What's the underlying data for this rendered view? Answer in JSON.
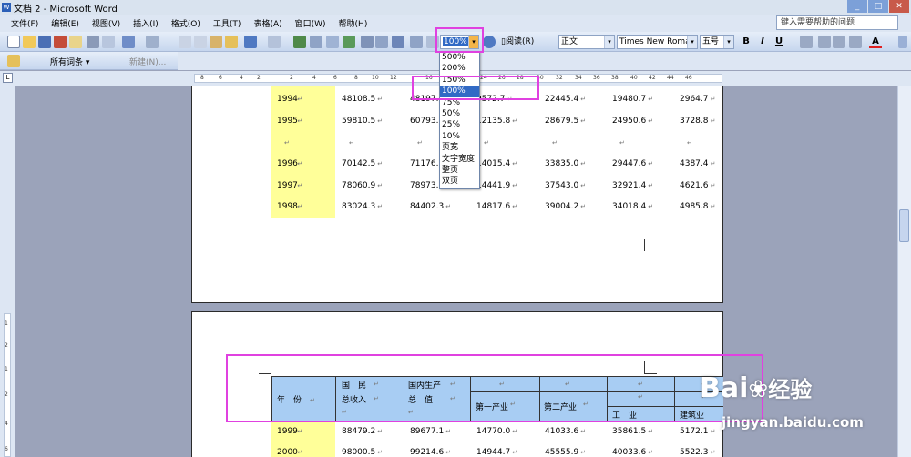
{
  "window": {
    "title": "文档 2 - Microsoft Word"
  },
  "menu": [
    "文件(F)",
    "编辑(E)",
    "视图(V)",
    "插入(I)",
    "格式(O)",
    "工具(T)",
    "表格(A)",
    "窗口(W)",
    "帮助(H)"
  ],
  "help": {
    "placeholder": "键入需要帮助的问题"
  },
  "toolbar": {
    "zoom_value": "100%",
    "read_label": "阅读(R)",
    "style_value": "正文",
    "font_value": "Times New Roman",
    "size_value": "五号",
    "bold": "B",
    "italic": "I",
    "underline": "U",
    "font_color": "A"
  },
  "toolbar2": {
    "all_entries": "所有词条",
    "new_label": "新建(N)..."
  },
  "ruler": {
    "ticks": [
      "8",
      "6",
      "4",
      "2",
      "2",
      "4",
      "6",
      "8",
      "10",
      "12",
      "16",
      "20",
      "22",
      "24",
      "26",
      "28",
      "30",
      "32",
      "34",
      "36",
      "38",
      "40",
      "42",
      "44",
      "46"
    ]
  },
  "vruler": {
    "ticks": [
      "1",
      "2",
      "1",
      "2",
      "4",
      "6"
    ]
  },
  "zoom_options": [
    "500%",
    "200%",
    "150%",
    "100%",
    "75%",
    "50%",
    "25%",
    "10%",
    "页宽",
    "文字宽度",
    "整页",
    "双页"
  ],
  "zoom_selected_index": 3,
  "table1": {
    "rows": [
      {
        "year": "1994",
        "c1": "48108.5",
        "c2": "48197.0",
        "c3": "9572.7",
        "c4": "22445.4",
        "c5": "19480.7",
        "c6": "2964.7"
      },
      {
        "year": "1995",
        "c1": "59810.5",
        "c2": "60793.7",
        "c3": "12135.8",
        "c4": "28679.5",
        "c5": "24950.6",
        "c6": "3728.8"
      },
      {
        "year": "",
        "c1": "",
        "c2": "",
        "c3": "",
        "c4": "",
        "c5": "",
        "c6": ""
      },
      {
        "year": "1996",
        "c1": "70142.5",
        "c2": "71176.6",
        "c3": "14015.4",
        "c4": "33835.0",
        "c5": "29447.6",
        "c6": "4387.4"
      },
      {
        "year": "1997",
        "c1": "78060.9",
        "c2": "78973.0",
        "c3": "14441.9",
        "c4": "37543.0",
        "c5": "32921.4",
        "c6": "4621.6"
      },
      {
        "year": "1998",
        "c1": "83024.3",
        "c2": "84402.3",
        "c3": "14817.6",
        "c4": "39004.2",
        "c5": "34018.4",
        "c6": "4985.8"
      }
    ]
  },
  "table2": {
    "header": {
      "year_label": "年　份",
      "gni_label_1": "国　民",
      "gni_label_2": "总收入",
      "gdp_label_1": "国内生产",
      "gdp_label_2": "总　值",
      "primary": "第一产业",
      "secondary": "第二产业",
      "industry": "工　业",
      "construction": "建筑业"
    },
    "rows": [
      {
        "year": "1999",
        "c1": "88479.2",
        "c2": "89677.1",
        "c3": "14770.0",
        "c4": "41033.6",
        "c5": "35861.5",
        "c6": "5172.1"
      },
      {
        "year": "2000",
        "c1": "98000.5",
        "c2": "99214.6",
        "c3": "14944.7",
        "c4": "45555.9",
        "c5": "40033.6",
        "c6": "5522.3"
      }
    ]
  },
  "para_mark": "↵",
  "watermark": {
    "brand": "Bai",
    "brand2": "经验",
    "url": "jingyan.baidu.com"
  },
  "colors": {
    "highlight": "#e041e0",
    "year_fill": "#ffff99",
    "header_fill": "#a8cdf3",
    "selection": "#316ac5"
  }
}
